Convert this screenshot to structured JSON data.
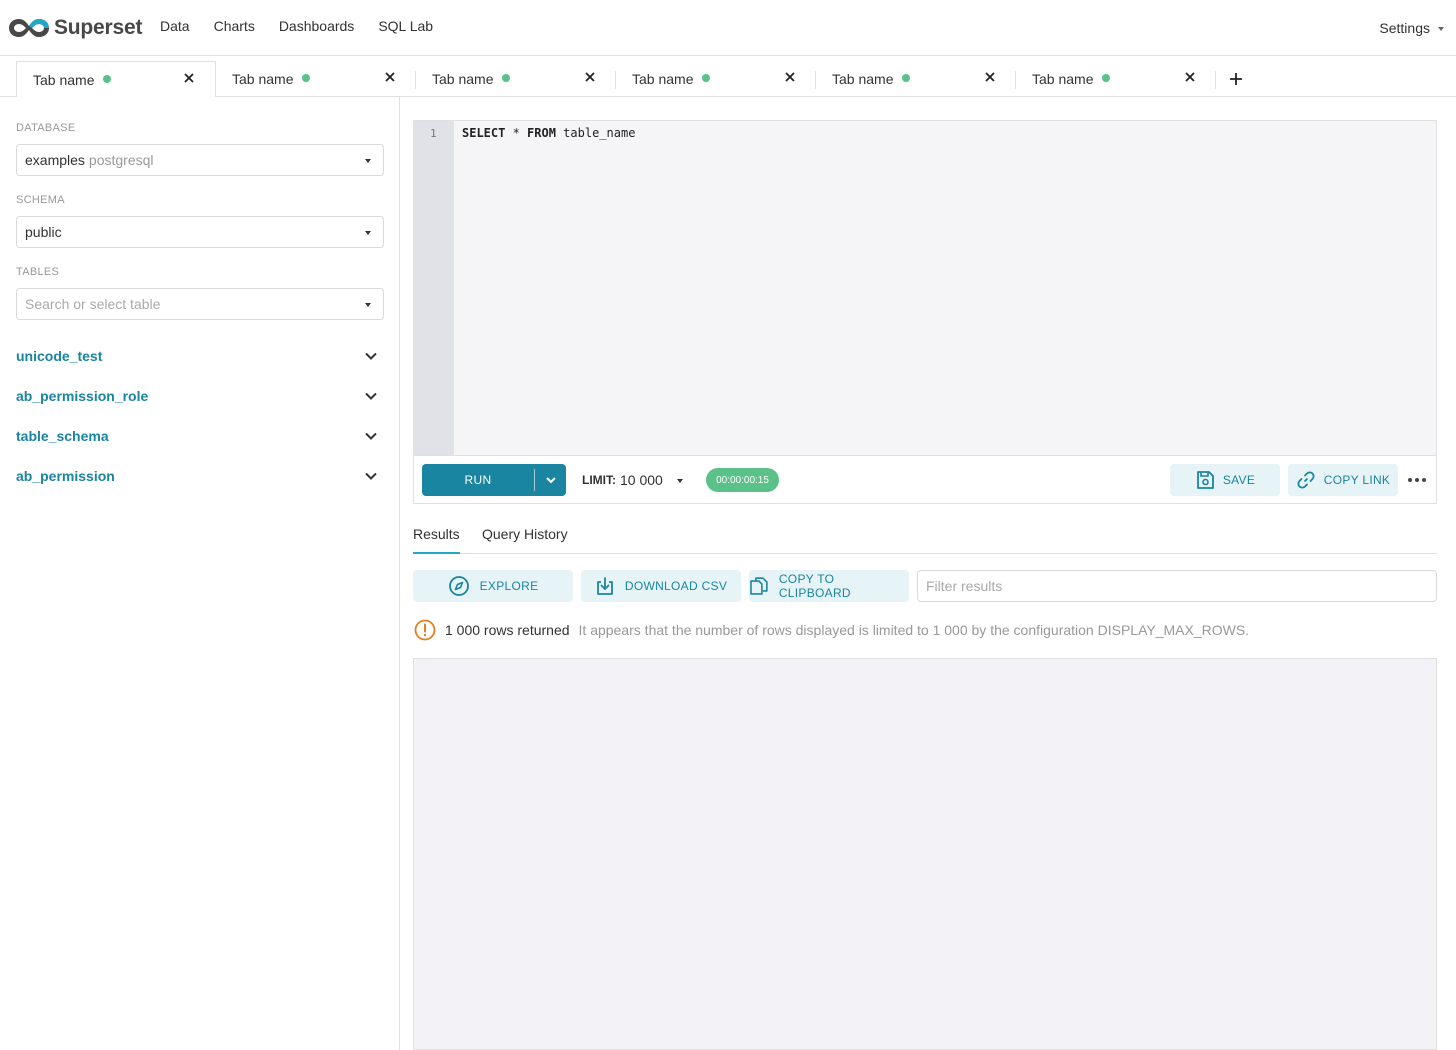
{
  "navbar": {
    "brand": "Superset",
    "links": [
      "Data",
      "Charts",
      "Dashboards",
      "SQL Lab"
    ],
    "settings": "Settings"
  },
  "tabs": [
    {
      "label": "Tab name",
      "active": true
    },
    {
      "label": "Tab name",
      "active": false
    },
    {
      "label": "Tab name",
      "active": false
    },
    {
      "label": "Tab name",
      "active": false
    },
    {
      "label": "Tab name",
      "active": false
    },
    {
      "label": "Tab name",
      "active": false
    }
  ],
  "left": {
    "database_label": "DATABASE",
    "database_value": "examples",
    "database_type": "postgresql",
    "schema_label": "SCHEMA",
    "schema_value": "public",
    "tables_label": "TABLES",
    "tables_placeholder": "Search or select table",
    "tables": [
      "unicode_test",
      "ab_permission_role",
      "table_schema",
      "ab_permission"
    ]
  },
  "editor": {
    "line": "1",
    "keyword1": "SELECT",
    "star": " * ",
    "keyword2": "FROM",
    "rest": " table_name"
  },
  "toolbar": {
    "run": "RUN",
    "limit_label": "LIMIT:",
    "limit_value": "10 000",
    "timer": "00:00:00:15",
    "save": "SAVE",
    "copy_link": "COPY LINK"
  },
  "results": {
    "tab_results": "Results",
    "tab_history": "Query History",
    "explore": "EXPLORE",
    "download_csv": "DOWNLOAD CSV",
    "copy_clipboard": "COPY TO CLIPBOARD",
    "filter_placeholder": "Filter results",
    "rows_returned": "1 000 rows returned",
    "limit_message": "It appears that the number of rows displayed is limited to 1 000 by the configuration DISPLAY_MAX_ROWS."
  },
  "colors": {
    "brand": "#1a85a0",
    "status_green": "#5ac189",
    "warning": "#e67e22"
  }
}
